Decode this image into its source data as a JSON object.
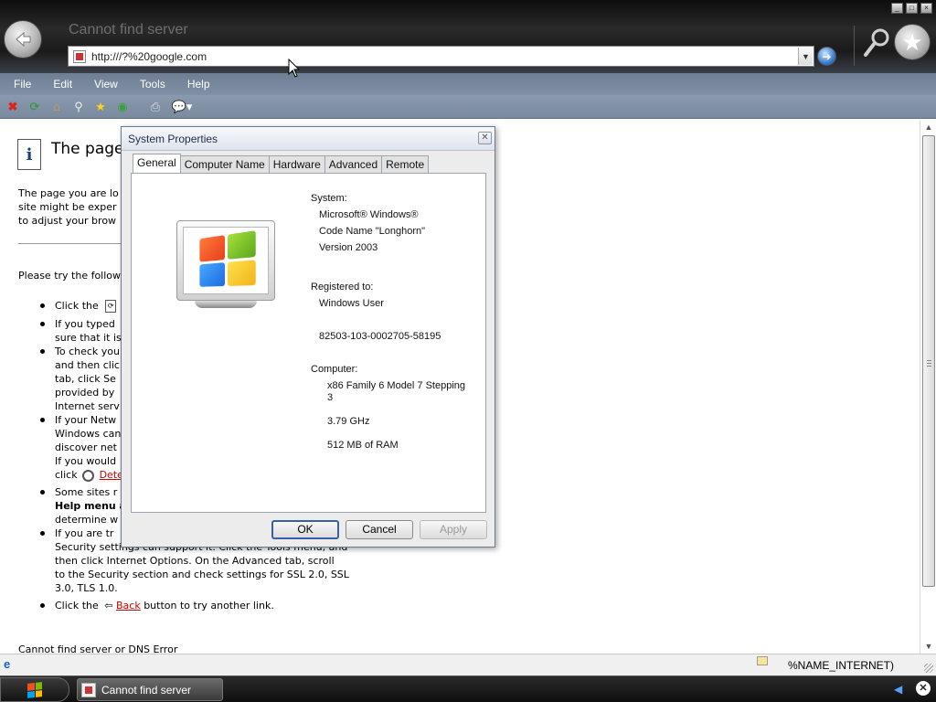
{
  "browser": {
    "title": "Cannot find server",
    "address": "http:///?%20google.com",
    "menu": [
      "File",
      "Edit",
      "View",
      "Tools",
      "Help"
    ]
  },
  "page": {
    "heading": "The page",
    "para_lines": [
      "The page you are lo",
      "site might be exper",
      "to adjust your brow"
    ],
    "try_text": "Please try the follow",
    "footer_text": "Cannot find server or DNS Error",
    "bullets": [
      {
        "lines": [
          "Click the"
        ]
      },
      {
        "lines": [
          "If you typed",
          "sure that it is"
        ]
      },
      {
        "lines": [
          "To check you",
          "and then clic",
          "tab, click Se",
          "provided by",
          "Internet serv"
        ]
      },
      {
        "lines": [
          "If your Netw",
          "Windows can",
          "discover net",
          "If you would",
          "click"
        ],
        "link": "Dete"
      },
      {
        "lines": [
          "Some sites r",
          "Help menu a",
          "determine w"
        ]
      },
      {
        "lines": [
          "If you are tr",
          "Security settings can support it. Click the Tools menu, and",
          "then click Internet Options. On the Advanced tab, scroll",
          "to the Security section and check settings for SSL 2.0, SSL",
          "3.0, TLS 1.0."
        ]
      },
      {
        "lines": [
          "Click the"
        ],
        "link": "Back",
        "tail": "button to try another link."
      }
    ]
  },
  "status": {
    "zone": "%NAME_INTERNET)"
  },
  "taskbar": {
    "task_label": "Cannot find server"
  },
  "dialog": {
    "title": "System Properties",
    "tabs": [
      "General",
      "Computer Name",
      "Hardware",
      "Advanced",
      "Remote"
    ],
    "active_tab": "General",
    "system_label": "System:",
    "system_lines": [
      "Microsoft® Windows®",
      "Code Name \"Longhorn\"",
      "Version 2003"
    ],
    "registered_label": "Registered to:",
    "registered_user": "Windows User",
    "product_id": "82503-103-0002705-58195",
    "computer_label": "Computer:",
    "cpu_lines": [
      "x86 Family 6 Model 7 Stepping",
      "3"
    ],
    "speed": "3.79 GHz",
    "ram": "512 MB of RAM",
    "ok": "OK",
    "cancel": "Cancel",
    "apply": "Apply"
  },
  "colors": {
    "menubar": "#7a89a0",
    "link": "#cc0000",
    "dialog_bg": "#ececec",
    "default_button_border": "#3b5ea8"
  },
  "icons": [
    "back-icon",
    "page-icon",
    "go-icon",
    "search-icon",
    "favorites-star-icon",
    "stop-icon",
    "refresh-icon",
    "home-icon",
    "print-icon",
    "info-icon",
    "windows-logo-icon"
  ]
}
